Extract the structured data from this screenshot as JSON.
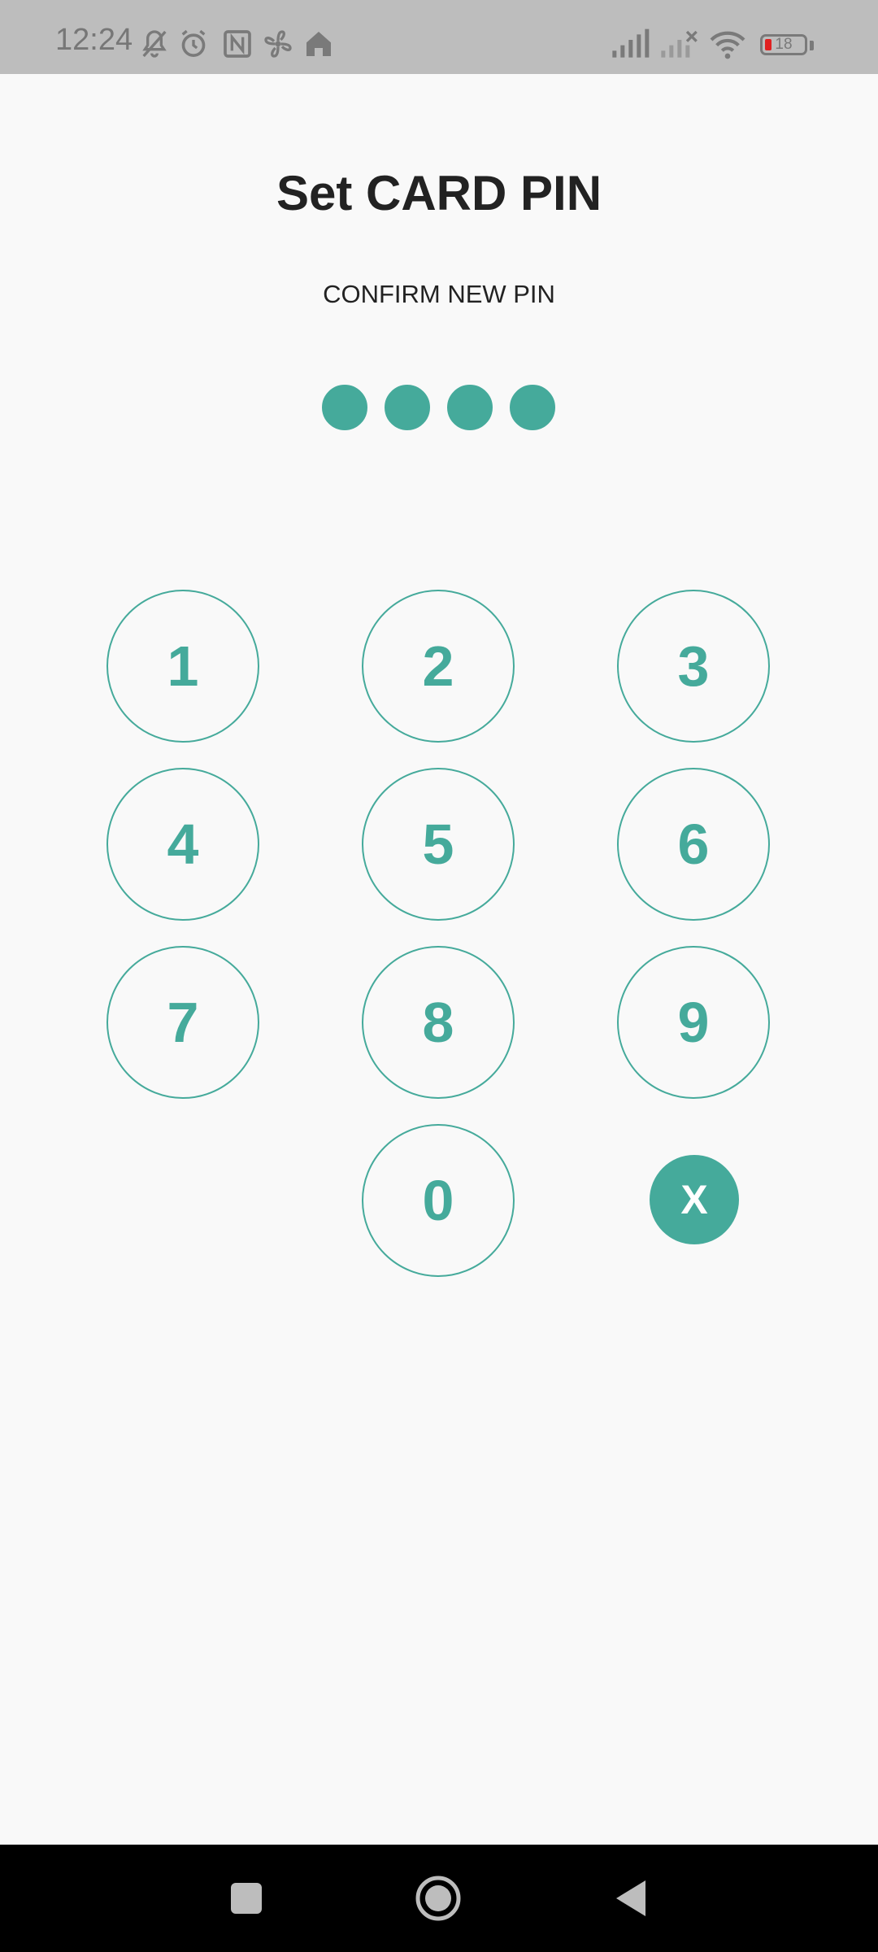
{
  "status_bar": {
    "time": "12:24",
    "battery_level": "18",
    "battery_fraction": 0.18,
    "icons": [
      "mute-icon",
      "alarm-icon",
      "nfc-icon",
      "fan-icon",
      "home-icon",
      "signal-icon",
      "signal-no-service-icon",
      "wifi-icon",
      "battery-icon"
    ]
  },
  "screen": {
    "title": "Set CARD PIN",
    "subtitle": "CONFIRM NEW PIN"
  },
  "pin": {
    "length": 4,
    "entered": 4,
    "color": "#45aa9b"
  },
  "keypad": {
    "keys": [
      "1",
      "2",
      "3",
      "4",
      "5",
      "6",
      "7",
      "8",
      "9",
      "0"
    ],
    "delete_label": "X",
    "accent": "#45aa9b"
  },
  "nav_bar": {
    "buttons": [
      "recents-icon",
      "home-icon",
      "back-icon"
    ]
  }
}
